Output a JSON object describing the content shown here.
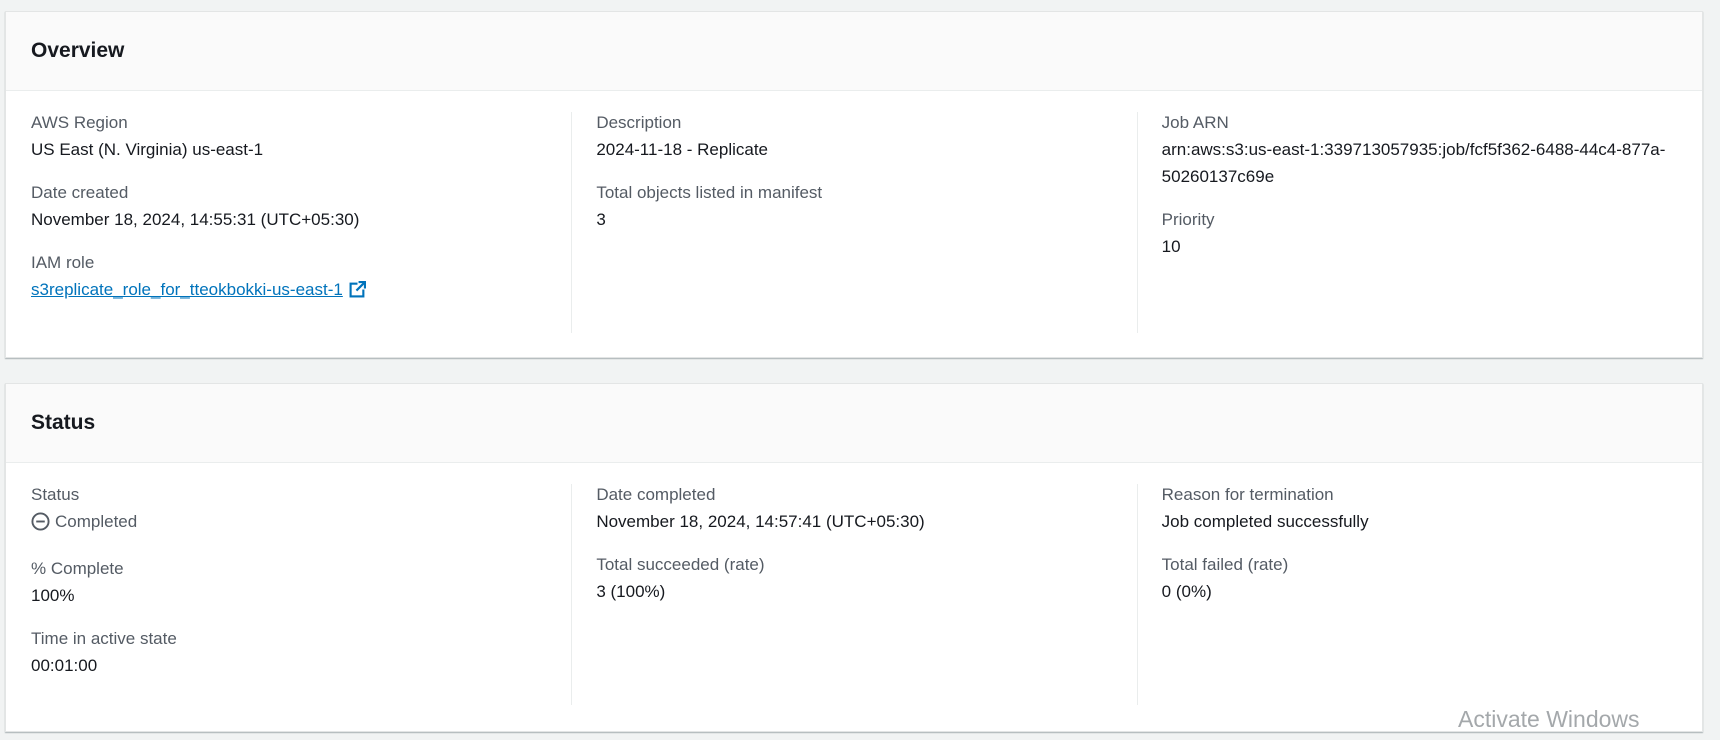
{
  "overview": {
    "title": "Overview",
    "aws_region": {
      "label": "AWS Region",
      "value": "US East (N. Virginia) us-east-1"
    },
    "date_created": {
      "label": "Date created",
      "value": "November 18, 2024, 14:55:31 (UTC+05:30)"
    },
    "iam_role": {
      "label": "IAM role",
      "value": "s3replicate_role_for_tteokbokki-us-east-1"
    },
    "description": {
      "label": "Description",
      "value": "2024-11-18 - Replicate"
    },
    "total_objects": {
      "label": "Total objects listed in manifest",
      "value": "3"
    },
    "job_arn": {
      "label": "Job ARN",
      "value": "arn:aws:s3:us-east-1:339713057935:job/fcf5f362-6488-44c4-877a-50260137c69e"
    },
    "priority": {
      "label": "Priority",
      "value": "10"
    }
  },
  "status_panel": {
    "title": "Status",
    "status": {
      "label": "Status",
      "value": "Completed",
      "icon": "minus-circle-icon"
    },
    "percent_complete": {
      "label": "% Complete",
      "value": "100%"
    },
    "time_active": {
      "label": "Time in active state",
      "value": "00:01:00"
    },
    "date_completed": {
      "label": "Date completed",
      "value": "November 18, 2024, 14:57:41 (UTC+05:30)"
    },
    "total_succeeded": {
      "label": "Total succeeded (rate)",
      "value": "3 (100%)"
    },
    "reason_termination": {
      "label": "Reason for termination",
      "value": "Job completed successfully"
    },
    "total_failed": {
      "label": "Total failed (rate)",
      "value": "0 (0%)"
    }
  },
  "watermark": "Activate Windows",
  "colors": {
    "link": "#0073bb",
    "label": "#545b64",
    "text": "#16191f",
    "background": "#f1f3f3"
  }
}
